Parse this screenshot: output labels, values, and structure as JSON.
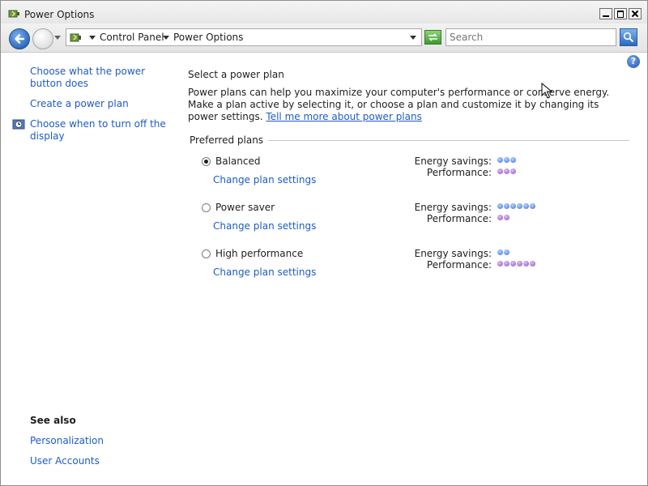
{
  "window": {
    "title": "Power Options"
  },
  "navigation": {
    "breadcrumbs": [
      "Control Panel",
      "Power Options"
    ],
    "search_placeholder": "Search"
  },
  "sidebar": {
    "links": [
      {
        "label": "Choose what the power button does"
      },
      {
        "label": "Create a power plan"
      },
      {
        "label": "Choose when to turn off the display"
      }
    ],
    "see_also": {
      "heading": "See also",
      "links": [
        {
          "label": "Personalization"
        },
        {
          "label": "User Accounts"
        }
      ]
    }
  },
  "main": {
    "heading": "Select a power plan",
    "description": "Power plans can help you maximize your computer's performance or conserve energy. Make a plan active by selecting it, or choose a plan and customize it by changing its power settings.",
    "description_link": "Tell me more about power plans",
    "preferred_heading": "Preferred plans",
    "energy_label": "Energy savings:",
    "performance_label": "Performance:",
    "plans": [
      {
        "name": "Balanced",
        "selected": true,
        "change_label": "Change plan settings",
        "energy_savings": 3,
        "performance": 3
      },
      {
        "name": "Power saver",
        "selected": false,
        "change_label": "Change plan settings",
        "energy_savings": 6,
        "performance": 2
      },
      {
        "name": "High performance",
        "selected": false,
        "change_label": "Change plan settings",
        "energy_savings": 2,
        "performance": 6
      }
    ]
  },
  "colors": {
    "link": "#1e5bc8",
    "energy_dots": "#3a6fd6",
    "performance_dots": "#8a4cc0"
  }
}
